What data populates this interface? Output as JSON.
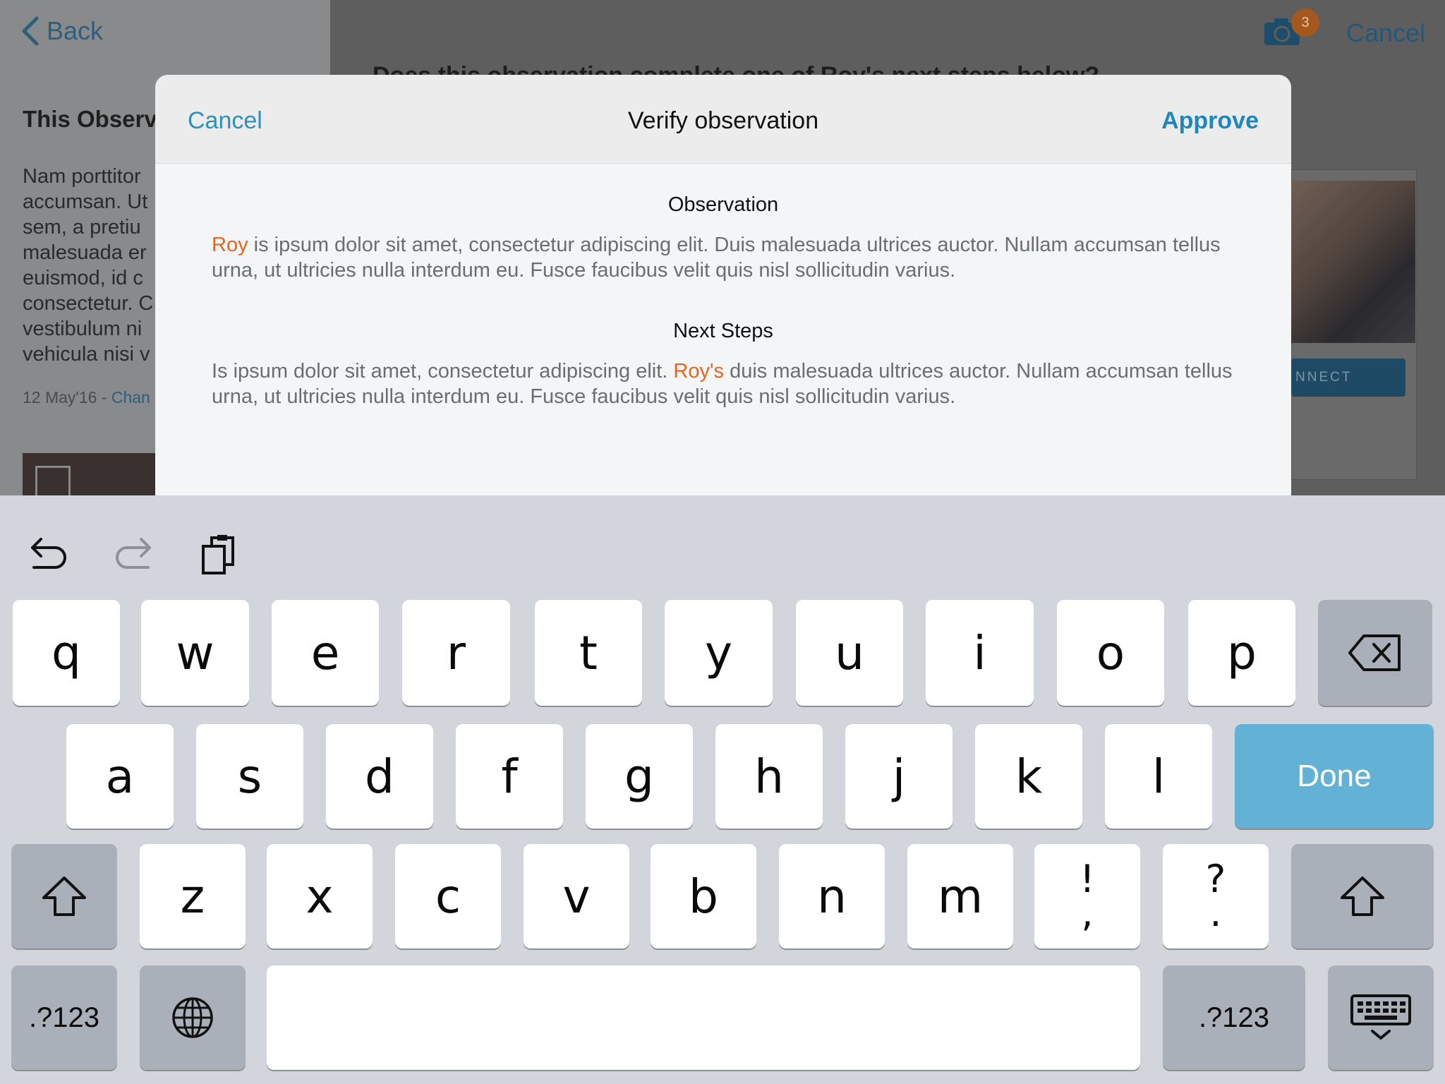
{
  "background": {
    "back_label": "Back",
    "section_title": "This Observ",
    "paragraph": "Nam porttitor\naccumsan. Ut\nsem, a pretiu\nmalesuada er\neuismod, id c\nconsectetur. C\nvestibulum ni\nvehicula nisi v",
    "date": "12 May'16",
    "date_sep": " - ",
    "date_link": "Chan",
    "question": "Does this observation complete one of Roy's next steps below?",
    "photo_badge": "3",
    "cancel_label": "Cancel",
    "connect_label": "NNECT"
  },
  "modal": {
    "cancel_label": "Cancel",
    "title": "Verify observation",
    "approve_label": "Approve",
    "observation": {
      "heading": "Observation",
      "name": "Roy",
      "text": " is ipsum dolor sit amet, consectetur adipiscing elit. Duis malesuada ultrices auctor. Nullam accumsan tellus urna, ut ultricies nulla interdum eu. Fusce faucibus velit quis nisl sollicitudin varius."
    },
    "next_steps": {
      "heading": "Next Steps",
      "text_before": "Is ipsum dolor sit amet, consectetur adipiscing elit. ",
      "name": "Roy's",
      "text_after": " duis malesuada ultrices auctor. Nullam accumsan tellus urna, ut ultricies nulla interdum eu. Fusce faucibus velit quis nisl sollicitudin varius."
    }
  },
  "keyboard": {
    "row1": [
      "q",
      "w",
      "e",
      "r",
      "t",
      "y",
      "u",
      "i",
      "o",
      "p"
    ],
    "row2": [
      "a",
      "s",
      "d",
      "f",
      "g",
      "h",
      "j",
      "k",
      "l"
    ],
    "row3": [
      "z",
      "x",
      "c",
      "v",
      "b",
      "n",
      "m"
    ],
    "punct1": {
      "top": "!",
      "bottom": ","
    },
    "punct2": {
      "top": "?",
      "bottom": "."
    },
    "done_label": "Done",
    "numbers_label": ".?123"
  },
  "colors": {
    "accent": "#2f8fbd",
    "highlight_name": "#e8641f",
    "done_key": "#64b1d6"
  }
}
